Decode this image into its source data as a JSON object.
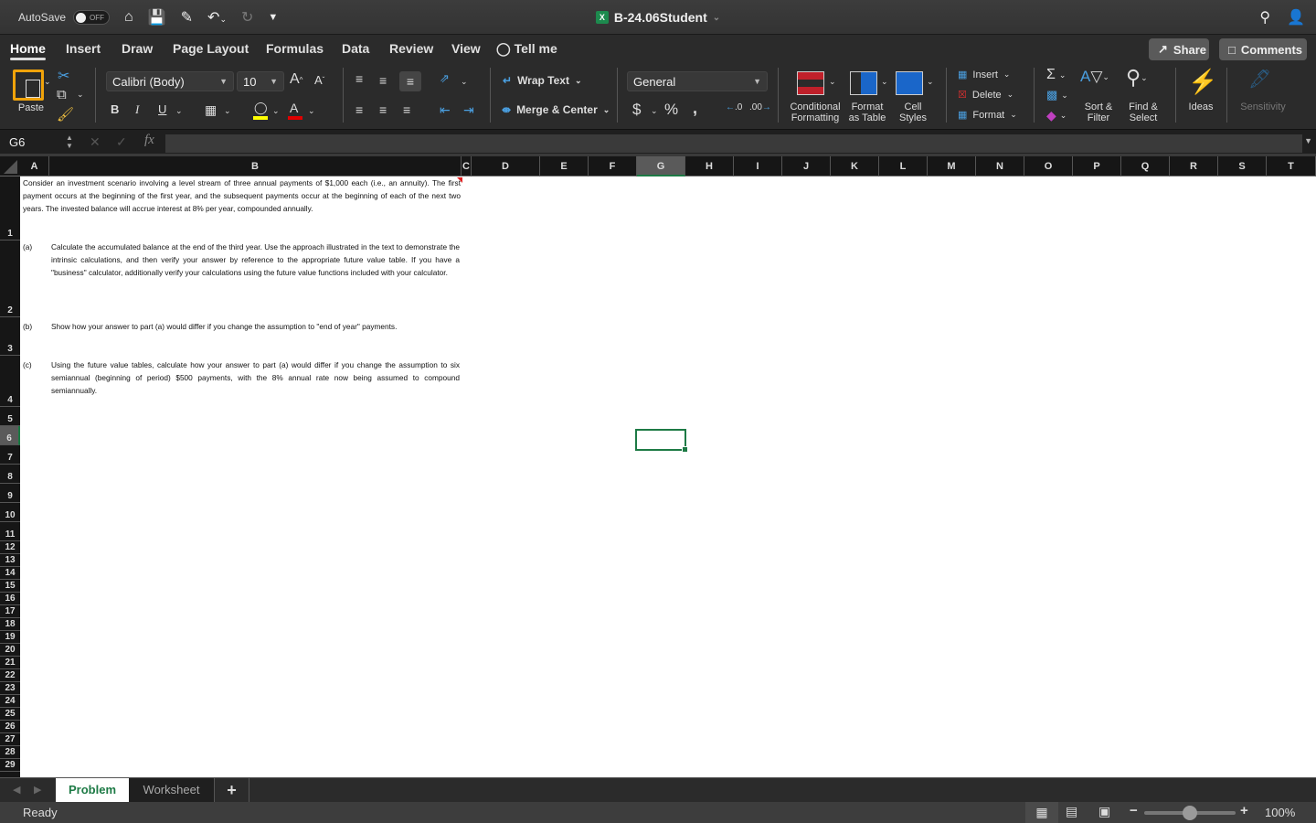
{
  "titlebar": {
    "autosave_label": "AutoSave",
    "autosave_state": "OFF",
    "document_title": "B-24.06Student",
    "icons": [
      "home-icon",
      "save-icon",
      "edit-icon",
      "undo-icon",
      "redo-icon",
      "customize-icon"
    ]
  },
  "menu": {
    "tabs": [
      "Home",
      "Insert",
      "Draw",
      "Page Layout",
      "Formulas",
      "Data",
      "Review",
      "View",
      "Tell me"
    ],
    "active_tab": "Home",
    "share_label": "Share",
    "comments_label": "Comments"
  },
  "ribbon": {
    "paste_label": "Paste",
    "font_name": "Calibri (Body)",
    "font_size": "10",
    "bold": "B",
    "italic": "I",
    "underline": "U",
    "wrap_text": "Wrap Text",
    "merge_center": "Merge & Center",
    "number_format": "General",
    "currency": "$",
    "percent": "%",
    "comma": ",",
    "conditional_formatting": [
      "Conditional",
      "Formatting"
    ],
    "format_as_table": [
      "Format",
      "as Table"
    ],
    "cell_styles": [
      "Cell",
      "Styles"
    ],
    "insert": "Insert",
    "delete": "Delete",
    "format": "Format",
    "sort_filter": [
      "Sort &",
      "Filter"
    ],
    "find_select": [
      "Find &",
      "Select"
    ],
    "ideas": "Ideas",
    "sensitivity": "Sensitivity",
    "fill_color": "#ffff00",
    "font_color": "#e00000"
  },
  "formula_bar": {
    "name_box": "G6",
    "formula": ""
  },
  "columns": [
    "A",
    "B",
    "C",
    "D",
    "E",
    "F",
    "G",
    "H",
    "I",
    "J",
    "K",
    "L",
    "M",
    "N",
    "O",
    "P",
    "Q",
    "R",
    "S",
    "T"
  ],
  "selected_column": "G",
  "rows": [
    "1",
    "2",
    "3",
    "4",
    "5",
    "6",
    "7",
    "8",
    "9",
    "10",
    "11",
    "12",
    "13",
    "14",
    "15",
    "16",
    "17",
    "18",
    "19",
    "20",
    "21",
    "22",
    "23",
    "24",
    "25",
    "26",
    "27",
    "28",
    "29"
  ],
  "selected_row": "6",
  "cells": {
    "A1": "Consider an investment scenario involving a level stream of three annual payments of $1,000 each (i.e., an annuity).  The first payment occurs at the beginning of the first year, and the subsequent payments occur at the beginning of each of the next two years.  The invested balance will accrue interest at 8% per year, compounded annually.",
    "A2": "(a)",
    "B2": "Calculate the accumulated balance at the end of the third year.  Use the approach illustrated in the text to demonstrate the intrinsic calculations, and then verify your answer by reference to the appropriate future value table.  If you have a \"business\" calculator, additionally verify your calculations using the future value functions included with your calculator.",
    "A3": "(b)",
    "B3": "Show how your answer to part (a) would differ if you change the assumption to \"end of year\" payments.",
    "A4": "(c)",
    "B4": "Using the future value tables, calculate how your answer to part (a) would differ if you change the assumption to six semiannual (beginning of period) $500 payments, with the 8% annual rate now being assumed to compound semiannually."
  },
  "sheets": {
    "tabs": [
      "Problem",
      "Worksheet"
    ],
    "active": "Problem",
    "add_label": "+"
  },
  "status": {
    "text": "Ready",
    "zoom": "100%",
    "zoom_fraction": 0.5
  }
}
